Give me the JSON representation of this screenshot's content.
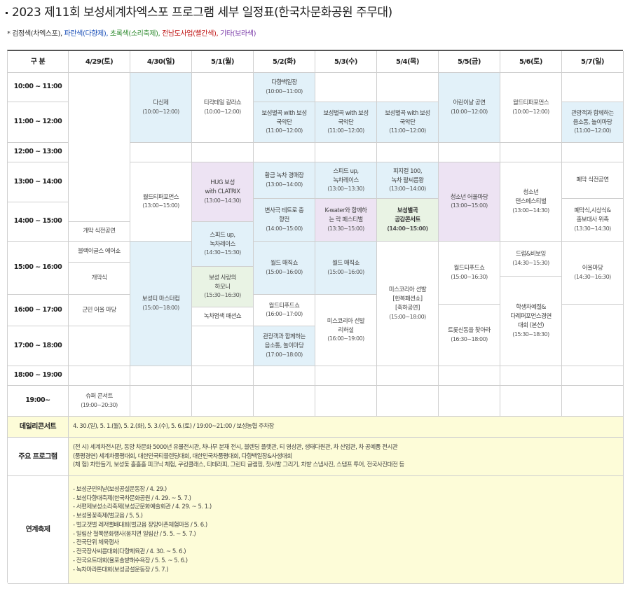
{
  "title": "2023 제11회 보성세계차엑스포 프로그램 세부 일정표(한국차문화공원 주무대)",
  "legend": {
    "black": "* 검정색(차엑스포),",
    "blue": "파란색(다향제),",
    "green": "초록색(소리축제),",
    "red": "전남도사업(빨간색),",
    "purple": "기타(보라색)"
  },
  "header": {
    "gubun": "구 분",
    "days": [
      "4/29(토)",
      "4/30(일)",
      "5/1(월)",
      "5/2(화)",
      "5/3(수)",
      "5/4(목)",
      "5/5(금)",
      "5/6(토)",
      "5/7(일)"
    ]
  },
  "times": [
    "10:00 ~ 11:00",
    "11:00 ~ 12:00",
    "12:00 ~ 13:00",
    "13:00 ~ 14:00",
    "14:00 ~ 15:00",
    "15:00 ~ 16:00",
    "16:00 ~ 17:00",
    "17:00 ~ 18:00",
    "18:00 ~ 19:00",
    "19:00~"
  ],
  "events": {
    "d429_opening": "개막 식전공연",
    "d429_black_eagles": "블랙이글스 에어쇼",
    "d429_ceremony": "개막식",
    "d429_military_band": "군민 어울 마당",
    "d429_super_concert": "슈퍼 콘서트",
    "d429_super_concert_time": "(19:00~20:30)",
    "d430_dashin": "다신제",
    "d430_dashin_time": "(10:00~12:00)",
    "d430_world_perf": "월드티퍼포먼스",
    "d430_world_perf_time": "(13:00~15:00)",
    "d430_master": "보성티 마스터컵",
    "d430_master_time": "(15:00~18:00)",
    "d51_teatail": "티칵테일 갈라쇼",
    "d51_teatail_time": "(10:00~12:00)",
    "d51_hug_1": "HUG 보성",
    "d51_hug_2": "with CLATRIX",
    "d51_hug_time": "(13:00~14:30)",
    "d51_speed_1": "스피드 up,",
    "d51_speed_2": "녹차레이스",
    "d51_speed_time": "(14:30~15:30)",
    "d51_harmony_1": "보성 사랑의",
    "d51_harmony_2": "하모니",
    "d51_harmony_time": "(15:30~16:30)",
    "d51_fashion": "녹차염색 패션쇼",
    "d52_dahyang": "다향백일장",
    "d52_dahyang_time": "(10:00~11:00)",
    "d52_gugak_1": "보성별곡 with 보성",
    "d52_gugak_2": "국악단",
    "d52_gugak_time": "(11:00~12:00)",
    "d52_golden": "황금 녹차 경매장",
    "d52_golden_time": "(13:00~14:00)",
    "d52_trot_1": "변사극 테트로 충",
    "d52_trot_2": "향전",
    "d52_trot_time": "(14:00~15:00)",
    "d52_magic": "월드 매직쇼",
    "d52_magic_time": "(15:00~16:00)",
    "d52_tifood": "월드티푸드쇼",
    "d52_tifood_time": "(16:00~17:00)",
    "d52_visitors_1": "관광객과 함께하는",
    "d52_visitors_2": "음소통, 놀이마당",
    "d52_visitors_time": "(17:00~18:00)",
    "d53_gugak_1": "보성별곡 with 보성",
    "d53_gugak_2": "국악단",
    "d53_gugak_time": "(11:00~12:00)",
    "d53_speed_1": "스피드 up,",
    "d53_speed_2": "녹차레이스",
    "d53_speed_time": "(13:00~13:30)",
    "d53_kwater_1": "K-water와 함께하",
    "d53_kwater_2": "는 락 페스티벌",
    "d53_kwater_time": "(13:30~15:00)",
    "d53_magic": "월드 매직쇼",
    "d53_magic_time": "(15:00~16:00)",
    "d53_miss_1": "미스코리아 선발",
    "d53_miss_2": "리허설",
    "d53_miss_time": "(16:00~19:00)",
    "d54_gugak_1": "보성별곡 with 보성",
    "d54_gugak_2": "국악단",
    "d54_gugak_time": "(11:00~12:00)",
    "d54_fitness_1": "피지컬 100,",
    "d54_fitness_2": "녹차 팔씨름왕",
    "d54_fitness_time": "(13:00~14:00)",
    "d54_concert_1": "보성별곡",
    "d54_concert_2": "공감콘서트",
    "d54_concert_time": "(14:00~15:00)",
    "d54_miss_1": "미스코리아 선발",
    "d54_miss_2": "[한복패션쇼]",
    "d54_miss_3": "[축하공연]",
    "d54_miss_time": "(15:00~18:00)",
    "d55_children": "어린이날 공연",
    "d55_children_time": "(10:00~12:00)",
    "d55_youth": "청소년 어울마당",
    "d55_youth_time": "(13:00~15:00)",
    "d55_tifood": "월드티푸드쇼",
    "d55_tifood_time": "(15:00~16:30)",
    "d55_trot": "트롯신동을 찾아라",
    "d55_trot_time": "(16:30~18:00)",
    "d56_world_perf": "월드티퍼포먼스",
    "d56_world_perf_time": "(10:00~12:00)",
    "d56_youth_1": "청소년",
    "d56_youth_2": "댄스페스티벌",
    "d56_youth_time": "(13:00~14:30)",
    "d56_drum": "드럼&비보잉",
    "d56_drum_time": "(14:30~15:30)",
    "d56_student_1": "학생차예절&",
    "d56_student_2": "다례퍼포먼스경연",
    "d56_student_3": "대회 (본선)",
    "d56_student_time": "(15:30~18:30)",
    "d57_visitors_1": "관광객과 함께하는",
    "d57_visitors_2": "음소통, 놀이마당",
    "d57_visitors_time": "(11:00~12:00)",
    "d57_closing_pre": "폐막 식전공연",
    "d57_closing_1": "폐막식,시상식&",
    "d57_closing_2": "홍보대사 위촉",
    "d57_closing_time": "(13:30~14:30)",
    "d57_eoul": "어울마당",
    "d57_eoul_time": "(14:30~16:30)"
  },
  "bottom": {
    "daily_label": "데일리콘서트",
    "daily_text": "4. 30.(일), 5. 1.(월), 5. 2.(화), 5. 3.(수), 5. 6.(토) / 19:00~21:00 / 보성농협 주차장",
    "main_label": "주요 프로그램",
    "main_lines": [
      "(전 시) 세계차전시관, 동양 차문화 5000년 유물전시관, 차나무 분재 전시, 블렌딩 플랫관, 티 영상관, 생태다원관, 차 산업관, 차 공예품 전시관",
      "(품평경연) 세계차품평대회, 대한민국티블렌딩대회, 대한민국차품평대회, 다향백일장&사생대회",
      "(체 험) 차만들기, 보성돛 홀홀홀 피크닉 체험, 쿠킹클래스, 티테라피, 그린티 글램핑, 찻사발 그리기, 차밭 스냅사진, 스탬프 투어, 전국사진대전 등"
    ],
    "festival_label": "연계축제",
    "festival_lines": [
      "- 보성군민의날(보성공설운동장 / 4. 29.)",
      "- 보성다향대축제(한국차문화공원 / 4. 29. ~ 5. 7.)",
      "- 서편제보성소리축제(보성군문화예술회관 / 4. 29. ~ 5. 1.)",
      "- 보성볼꽃축제(벌교읍 / 5. 5.)",
      "- 벌교갯벌 레저뻘배대회(벌교읍 장양어촌체험마을 / 5. 6.)",
      "- 일림산 철쭉문화행사(웅치면 일림산 / 5. 5. ~ 5. 7.)",
      "- 전국단위 체육행사",
      "- 전국장사씨름대회(다향체육관 / 4. 30. ~ 5. 6.)",
      "- 전국요트대회(율포솔밭해수욕장 / 5. 5. ~ 5. 6.)",
      "- 녹차마라톤대회(보성공설운동장 / 5. 7.)"
    ]
  }
}
